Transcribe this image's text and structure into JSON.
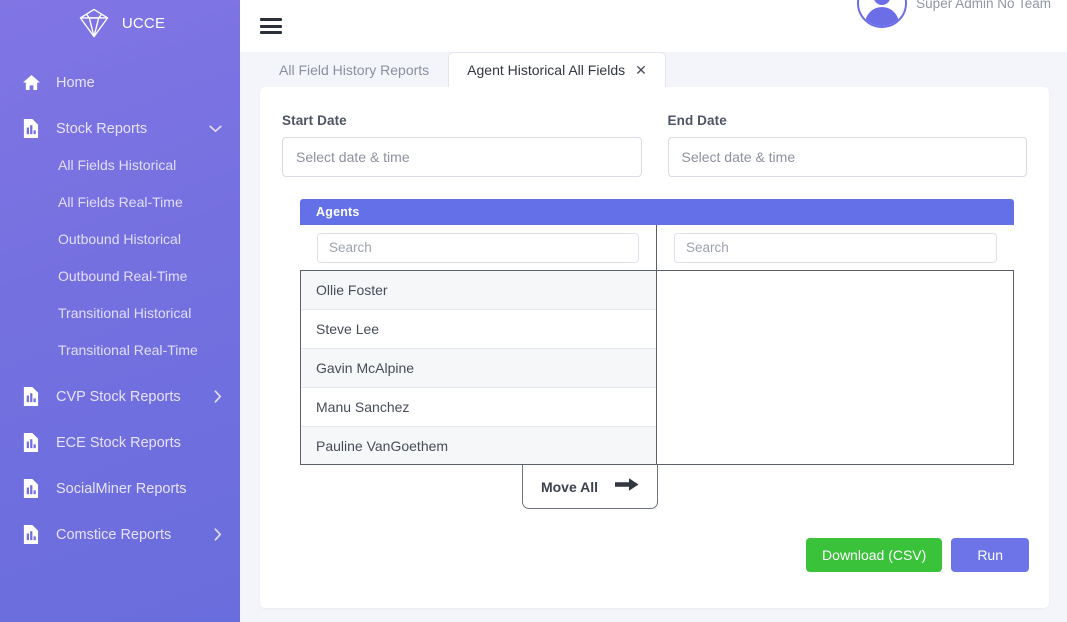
{
  "sidebar": {
    "brand": {
      "name": "UCCE",
      "logo_icon": "diamond-gem-icon"
    },
    "items": [
      {
        "label": "Home",
        "icon": "home-icon",
        "caret": ""
      },
      {
        "label": "Stock Reports",
        "icon": "report-document-icon",
        "caret": "chevron-down-icon"
      }
    ],
    "stock_reports_children": [
      {
        "label": "All Fields Historical"
      },
      {
        "label": "All Fields Real-Time"
      },
      {
        "label": "Outbound Historical"
      },
      {
        "label": "Outbound Real-Time"
      },
      {
        "label": "Transitional Historical"
      },
      {
        "label": "Transitional Real-Time"
      }
    ],
    "groups": [
      {
        "label": "CVP Stock Reports",
        "icon": "report-document-icon",
        "caret": "chevron-right-icon"
      },
      {
        "label": "ECE Stock Reports",
        "icon": "report-document-icon",
        "caret": ""
      },
      {
        "label": "SocialMiner Reports",
        "icon": "report-document-icon",
        "caret": ""
      },
      {
        "label": "Comstice Reports",
        "icon": "report-document-icon",
        "caret": "chevron-right-icon"
      }
    ]
  },
  "topbar": {
    "menu_icon": "hamburger-menu-icon",
    "user_name": "Super Admin No Team",
    "avatar_icon": "user-avatar-icon"
  },
  "tabs": [
    {
      "label": "All Field History Reports",
      "active": false,
      "closable": false
    },
    {
      "label": "Agent Historical All Fields",
      "active": true,
      "closable": true,
      "close_glyph": "✕"
    }
  ],
  "form": {
    "start_date": {
      "label": "Start Date",
      "value": "",
      "placeholder": "Select date & time"
    },
    "end_date": {
      "label": "End Date",
      "value": "",
      "placeholder": "Select date & time"
    }
  },
  "picker": {
    "title": "Agents",
    "left_search": {
      "value": "",
      "placeholder": "Search"
    },
    "right_search": {
      "value": "",
      "placeholder": "Search"
    },
    "available": [
      {
        "name": "Ollie Foster"
      },
      {
        "name": "Steve Lee"
      },
      {
        "name": "Gavin McAlpine"
      },
      {
        "name": "Manu Sanchez"
      },
      {
        "name": "Pauline VanGoethem"
      }
    ],
    "selected": [],
    "move_all": {
      "label": "Move All",
      "icon": "arrow-right-icon"
    }
  },
  "actions": {
    "download": "Download (CSV)",
    "run": "Run"
  },
  "colors": {
    "sidebar_start": "#8175e4",
    "sidebar_end": "#6a6ddd",
    "accent_indigo": "#6370e8",
    "run_button": "#6c74e8",
    "download_green": "#3ac23a",
    "page_background": "#f4f5fa"
  }
}
